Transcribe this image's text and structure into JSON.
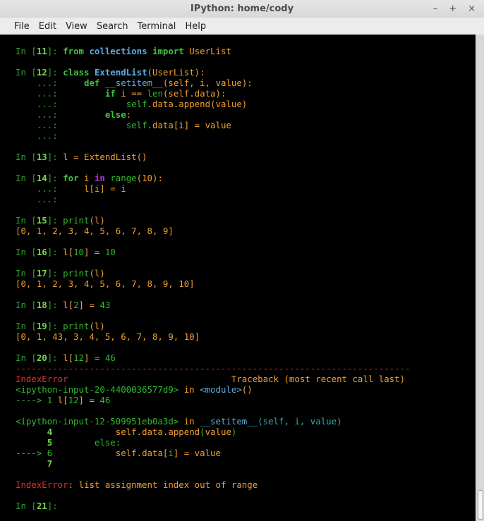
{
  "window": {
    "title": "IPython: home/cody",
    "controls": [
      "–",
      "+",
      "×"
    ]
  },
  "menu": {
    "items": [
      "File",
      "Edit",
      "View",
      "Search",
      "Terminal",
      "Help"
    ]
  },
  "terminal": {
    "in_prompt": "In [",
    "prompt_close": "]: ",
    "cont_prompt": "...: ",
    "numbers": [
      "11",
      "12",
      "13",
      "14",
      "15",
      "16",
      "17",
      "18",
      "19",
      "20",
      "21"
    ],
    "code": {
      "from": "from",
      "collections": "collections",
      "import": "import",
      "UserList": "UserList",
      "class": "class",
      "ExtendList": "ExtendList",
      "paren_userlist": "(UserList):",
      "def": "def",
      "setitem": "__setitem__",
      "args": "(self, i, value):",
      "if": "if",
      "cond_a": " i == ",
      "len": "len",
      "cond_b": "(self.data):",
      "append_self": "self",
      "append_rest": ".data.append(value)",
      "else": "else",
      "colon": ":",
      "assign_self": "self",
      "assign_rest": ".data[i] = value",
      "l_assign": "l = ExtendList()",
      "for": "for",
      "i_var": " i ",
      "in": "in",
      "range": " range",
      "range_args": "(10):",
      "loop_body": "l[i] = i",
      "print": "print",
      "print_args": "(l)",
      "out1": "[0, 1, 2, 3, 4, 5, 6, 7, 8, 9]",
      "set10_a": "l[",
      "set10_b": "10",
      "set10_c": "] = ",
      "set10_d": "10",
      "out2": "[0, 1, 2, 3, 4, 5, 6, 7, 8, 9, 10]",
      "set2_a": "l[",
      "set2_b": "2",
      "set2_c": "] = ",
      "set2_d": "43",
      "out3": "[0, 1, 43, 3, 4, 5, 6, 7, 8, 9, 10]",
      "set12_a": "l[",
      "set12_b": "12",
      "set12_c": "] = ",
      "set12_d": "46"
    },
    "traceback": {
      "separator": "---------------------------------------------------------------------------",
      "error_name": "IndexError",
      "header": "Traceback (most recent call last)",
      "frame1_file": "<ipython-input-20-4400036577d9>",
      "in_word": " in ",
      "frame1_func": "<module>",
      "frame1_parens": "()",
      "arrow": "---->",
      "f1_lineno": " 1 ",
      "f1_code_a": "l[",
      "f1_code_b": "12",
      "f1_code_c": "] = ",
      "f1_code_d": "46",
      "frame2_file": "<ipython-input-12-509951eb0a3d>",
      "frame2_func": "__setitem__",
      "frame2_args": "(self, i, value)",
      "l4": "4",
      "l4_code_a": "self",
      "l4_code_b": ".data.append",
      "l4_code_c": "(",
      "l4_code_d": "value",
      "l4_code_e": ")",
      "l5": "5",
      "l5_code": "else:",
      "l6": " 6",
      "l6_code_a": "self",
      "l6_code_b": ".data[",
      "l6_code_c": "i",
      "l6_code_d": "] = value",
      "l7": "7",
      "final_name": "IndexError",
      "final_msg": ": list assignment index out of range"
    }
  }
}
